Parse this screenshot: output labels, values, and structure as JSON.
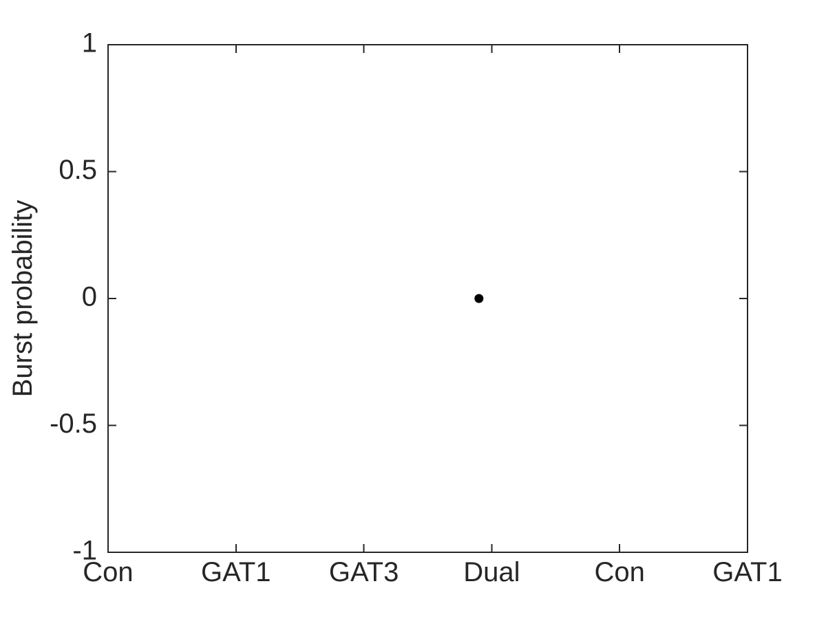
{
  "chart_data": {
    "type": "scatter",
    "title": "",
    "xlabel": "",
    "ylabel": "Burst probability",
    "categories": [
      "Con",
      "GAT1",
      "GAT3",
      "Dual",
      "Con",
      "GAT1"
    ],
    "xtick_labels": [
      "Con",
      "GAT1",
      "GAT3",
      "Dual",
      "Con",
      "GAT1"
    ],
    "xtick_positions": [
      0,
      1,
      2,
      3,
      4,
      5
    ],
    "xlim": [
      0,
      5
    ],
    "ylim": [
      -1,
      1
    ],
    "ytick_labels": [
      "1",
      "0.5",
      "0",
      "-0.5",
      "-1"
    ],
    "ytick_values": [
      1,
      0.5,
      0,
      -0.5,
      -1
    ],
    "grid": false,
    "legend": null,
    "legend_position": "none",
    "box": true,
    "tick_direction": "in",
    "series": [
      {
        "name": "Burst probability",
        "marker": "filled-circle",
        "color": "#000000",
        "marker_size": 13,
        "points": [
          {
            "x": 2.9,
            "y": 0,
            "category": "Dual"
          }
        ]
      }
    ]
  },
  "axes": {
    "y_title": "Burst probability",
    "y_ticks": [
      {
        "value": 1,
        "label": "1"
      },
      {
        "value": 0.5,
        "label": "0.5"
      },
      {
        "value": 0,
        "label": "0"
      },
      {
        "value": -0.5,
        "label": "-0.5"
      },
      {
        "value": -1,
        "label": "-1"
      }
    ],
    "x_ticks": [
      {
        "value": 0,
        "label": "Con"
      },
      {
        "value": 1,
        "label": "GAT1"
      },
      {
        "value": 2,
        "label": "GAT3"
      },
      {
        "value": 3,
        "label": "Dual"
      },
      {
        "value": 4,
        "label": "Con"
      },
      {
        "value": 5,
        "label": "GAT1"
      }
    ]
  },
  "style": {
    "axis_color": "#262626",
    "marker_color": "#000000",
    "background": "#ffffff"
  }
}
